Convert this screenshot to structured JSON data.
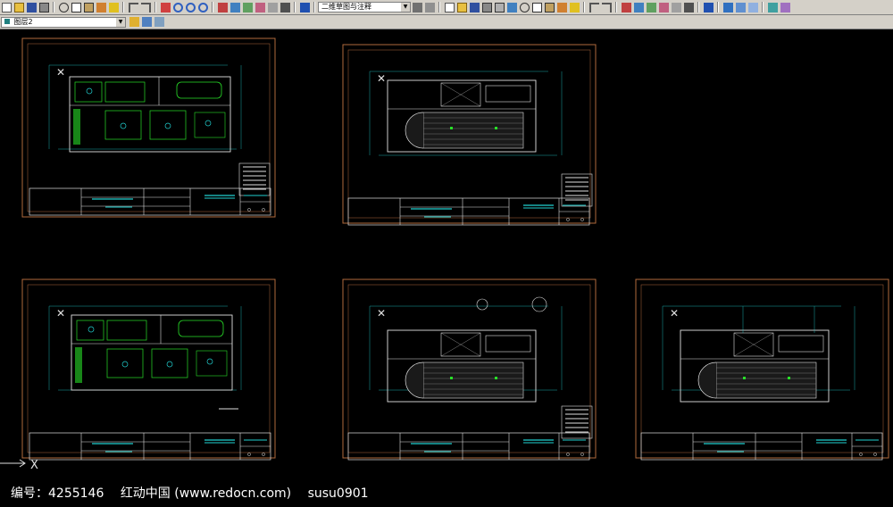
{
  "toolbar": {
    "view_combo": "二维草图与注释"
  },
  "layer_bar": {
    "layer_combo": "图层2"
  },
  "sheet": {
    "title_project_label": "工程名称:",
    "design_label": "设计:",
    "draw_label": "制图:",
    "check_label": "审核:",
    "approve_label": "工程负责人:",
    "drawing_name_label": "图名:"
  },
  "footer": {
    "id_text": "编号：4255146",
    "site_text": "红动中国 (www.redocn.com)",
    "user_text": "susu0901"
  },
  "colors": {
    "frame": "#b06a3c",
    "green": "#28e028",
    "cyan": "#20d0d0",
    "white": "#e0e0e0"
  }
}
